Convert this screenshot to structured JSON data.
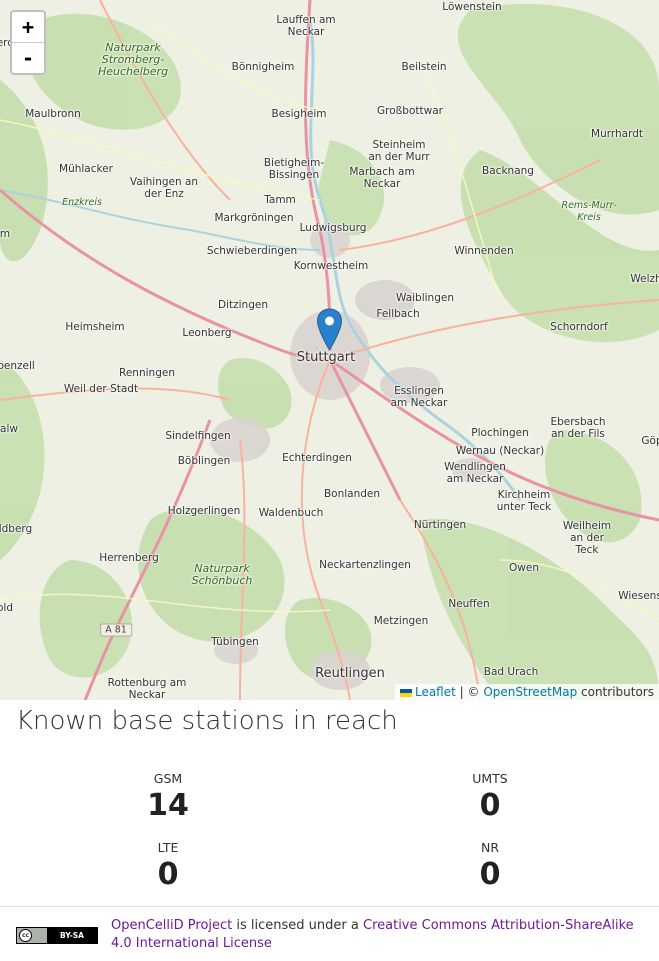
{
  "map": {
    "zoom_in_label": "+",
    "zoom_out_label": "-",
    "marker_icon": "map-pin-icon",
    "places": [
      {
        "name": "Löwenstein",
        "type": "town"
      },
      {
        "name": "Lauffen am Neckar",
        "type": "town"
      },
      {
        "name": "erdingen",
        "type": "town"
      },
      {
        "name": "Naturpark Stromberg-Heuchelberg",
        "type": "park"
      },
      {
        "name": "Bönnigheim",
        "type": "town"
      },
      {
        "name": "Beilstein",
        "type": "town"
      },
      {
        "name": "Maulbronn",
        "type": "town"
      },
      {
        "name": "Besigheim",
        "type": "town"
      },
      {
        "name": "Großbottwar",
        "type": "town"
      },
      {
        "name": "Murrhardt",
        "type": "town"
      },
      {
        "name": "Steinheim an der Murr",
        "type": "town"
      },
      {
        "name": "Mühlacker",
        "type": "town"
      },
      {
        "name": "Bietigheim-Bissingen",
        "type": "town"
      },
      {
        "name": "Marbach am Neckar",
        "type": "town"
      },
      {
        "name": "Backnang",
        "type": "town"
      },
      {
        "name": "Vaihingen an der Enz",
        "type": "town"
      },
      {
        "name": "Enzkreis",
        "type": "kreis"
      },
      {
        "name": "Tamm",
        "type": "town"
      },
      {
        "name": "Rems-Murr-Kreis",
        "type": "kreis"
      },
      {
        "name": "Markgröningen",
        "type": "town"
      },
      {
        "name": "Ludwigsburg",
        "type": "town"
      },
      {
        "name": "Schwieberdingen",
        "type": "town"
      },
      {
        "name": "Winnenden",
        "type": "town"
      },
      {
        "name": "Welzh",
        "type": "town"
      },
      {
        "name": "Kornwestheim",
        "type": "town"
      },
      {
        "name": "Waiblingen",
        "type": "town"
      },
      {
        "name": "Ditzingen",
        "type": "town"
      },
      {
        "name": "Fellbach",
        "type": "town"
      },
      {
        "name": "Heimsheim",
        "type": "town"
      },
      {
        "name": "Leonberg",
        "type": "town"
      },
      {
        "name": "Schorndorf",
        "type": "town"
      },
      {
        "name": "Stuttgart",
        "type": "city"
      },
      {
        "name": "benzell",
        "type": "town"
      },
      {
        "name": "Renningen",
        "type": "town"
      },
      {
        "name": "Weil der Stadt",
        "type": "town"
      },
      {
        "name": "Esslingen am Neckar",
        "type": "town"
      },
      {
        "name": "Ebersbach an der Fils",
        "type": "town"
      },
      {
        "name": "Sindelfingen",
        "type": "town"
      },
      {
        "name": "Plochingen",
        "type": "town"
      },
      {
        "name": "Göp",
        "type": "town"
      },
      {
        "name": "Echterdingen",
        "type": "town"
      },
      {
        "name": "Wernau (Neckar)",
        "type": "town"
      },
      {
        "name": "Böblingen",
        "type": "town"
      },
      {
        "name": "Wendlingen am Neckar",
        "type": "town"
      },
      {
        "name": "Bonlanden",
        "type": "town"
      },
      {
        "name": "Kirchheim unter Teck",
        "type": "town"
      },
      {
        "name": "Holzgerlingen",
        "type": "town"
      },
      {
        "name": "Waldenbuch",
        "type": "town"
      },
      {
        "name": "Nürtingen",
        "type": "town"
      },
      {
        "name": "ildberg",
        "type": "town"
      },
      {
        "name": "Weilheim an der Teck",
        "type": "town"
      },
      {
        "name": "Herrenberg",
        "type": "town"
      },
      {
        "name": "Neckartenzlingen",
        "type": "town"
      },
      {
        "name": "Owen",
        "type": "town"
      },
      {
        "name": "Naturpark Schönbuch",
        "type": "park"
      },
      {
        "name": "Wiesens",
        "type": "town"
      },
      {
        "name": "Neuffen",
        "type": "town"
      },
      {
        "name": "Metzingen",
        "type": "town"
      },
      {
        "name": "Tübingen",
        "type": "town"
      },
      {
        "name": "Reutlingen",
        "type": "city"
      },
      {
        "name": "Bad Urach",
        "type": "town"
      },
      {
        "name": "Rottenburg am Neckar",
        "type": "town"
      },
      {
        "name": "m",
        "type": "town"
      },
      {
        "name": "alw",
        "type": "town"
      },
      {
        "name": "old",
        "type": "town"
      }
    ],
    "road_shield": "A 81",
    "attribution": {
      "leaflet": "Leaflet",
      "separator": "| ©",
      "osm": "OpenStreetMap",
      "suffix": "contributors"
    }
  },
  "stations": {
    "heading": "Known base stations in reach",
    "items": [
      {
        "label": "GSM",
        "count": "14"
      },
      {
        "label": "UMTS",
        "count": "0"
      },
      {
        "label": "LTE",
        "count": "0"
      },
      {
        "label": "NR",
        "count": "0"
      }
    ]
  },
  "footer": {
    "license_badge": "BY-SA",
    "project_link": "OpenCelliD Project",
    "middle_text": "is licensed under a",
    "license_link": "Creative Commons Attribution-ShareAlike 4.0 International License"
  }
}
